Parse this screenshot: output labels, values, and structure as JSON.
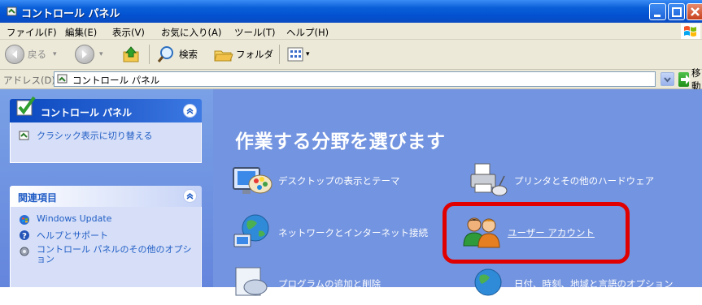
{
  "window": {
    "title": "コントロール パネル"
  },
  "menu": {
    "items": [
      "ファイル(F)",
      "編集(E)",
      "表示(V)",
      "お気に入り(A)",
      "ツール(T)",
      "ヘルプ(H)"
    ]
  },
  "toolbar": {
    "back_label": "戻る",
    "search_label": "検索",
    "folders_label": "フォルダ"
  },
  "address": {
    "label": "アドレス(D)",
    "value": "コントロール パネル",
    "go_label": "移動"
  },
  "sidebar": {
    "control_panel": {
      "title": "コントロール パネル",
      "items": [
        {
          "label": "クラシック表示に切り替える",
          "icon": "switch-view-icon"
        }
      ]
    },
    "related": {
      "title": "関連項目",
      "items": [
        {
          "label": "Windows Update",
          "icon": "windows-update-icon"
        },
        {
          "label": "ヘルプとサポート",
          "icon": "help-icon"
        },
        {
          "label": "コントロール パネルのその他のオプション",
          "icon": "gear-icon"
        }
      ]
    }
  },
  "main": {
    "heading": "作業する分野を選びます",
    "categories": [
      {
        "label": "デスクトップの表示とテーマ",
        "icon": "desktop-theme-icon"
      },
      {
        "label": "プリンタとその他のハードウェア",
        "icon": "printer-icon"
      },
      {
        "label": "ネットワークとインターネット接続",
        "icon": "network-globe-icon"
      },
      {
        "label": "ユーザー アカウント",
        "icon": "user-accounts-icon"
      },
      {
        "label": "プログラムの追加と削除",
        "icon": "add-remove-programs-icon"
      },
      {
        "label": "日付、時刻、地域と言語のオプション",
        "icon": "date-time-globe-icon"
      }
    ]
  },
  "colors": {
    "highlight": "#e00000",
    "content_bg": "#7394e0",
    "title_bar": "#0a5fd8"
  }
}
